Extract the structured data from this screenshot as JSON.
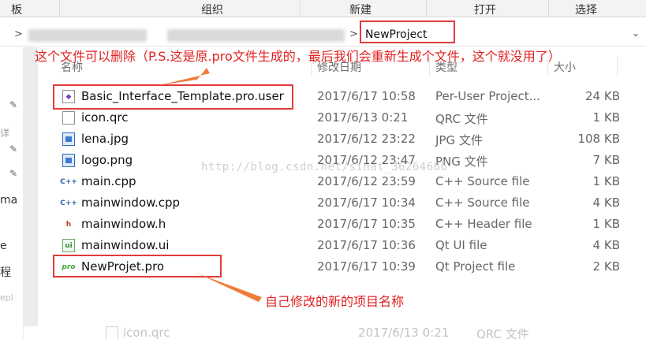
{
  "ribbon": {
    "groups": [
      "板",
      "组织",
      "新建",
      "打开",
      "选择"
    ]
  },
  "address": {
    "current_folder": "NewProject",
    "chevron": ">"
  },
  "nav": {
    "fragments": [
      "详",
      "ma",
      "e",
      "程",
      "epl"
    ]
  },
  "columns": {
    "name": "名称",
    "modified": "修改日期",
    "type": "类型",
    "size": "大小"
  },
  "files": [
    {
      "name": "Basic_Interface_Template.pro.user",
      "modified": "2017/6/17 10:58",
      "type": "Per-User Project...",
      "size": "24 KB",
      "icon": "user-file-icon"
    },
    {
      "name": "icon.qrc",
      "modified": "2017/6/13 0:21",
      "type": "QRC 文件",
      "size": "1 KB",
      "icon": "document-icon"
    },
    {
      "name": "lena.jpg",
      "modified": "2017/6/12 23:22",
      "type": "JPG 文件",
      "size": "108 KB",
      "icon": "image-icon"
    },
    {
      "name": "logo.png",
      "modified": "2017/6/12 23:47",
      "type": "PNG 文件",
      "size": "7 KB",
      "icon": "image-icon"
    },
    {
      "name": "main.cpp",
      "modified": "2017/6/12 23:59",
      "type": "C++ Source file",
      "size": "1 KB",
      "icon": "cpp-file-icon"
    },
    {
      "name": "mainwindow.cpp",
      "modified": "2017/6/17 10:34",
      "type": "C++ Source file",
      "size": "4 KB",
      "icon": "cpp-file-icon"
    },
    {
      "name": "mainwindow.h",
      "modified": "2017/6/17 10:35",
      "type": "C++ Header file",
      "size": "1 KB",
      "icon": "header-file-icon"
    },
    {
      "name": "mainwindow.ui",
      "modified": "2017/6/17 10:36",
      "type": "Qt UI file",
      "size": "4 KB",
      "icon": "qt-ui-file-icon"
    },
    {
      "name": "NewProjet.pro",
      "modified": "2017/6/17 10:39",
      "type": "Qt Project file",
      "size": "2 KB",
      "icon": "qt-project-file-icon"
    }
  ],
  "ghost_row": {
    "name": "icon.qrc",
    "modified": "2017/6/13 0:21",
    "type": "QRC 文件"
  },
  "annotations": {
    "top_note": "这个文件可以删除（P.S.这是原.pro文件生成的，最后我们会重新生成个文件，这个就没用了）",
    "bottom_note": "自己修改的新的项目名称",
    "color": "#e22020"
  },
  "watermark": "http://blog.csdn.net/sinat_36264666"
}
